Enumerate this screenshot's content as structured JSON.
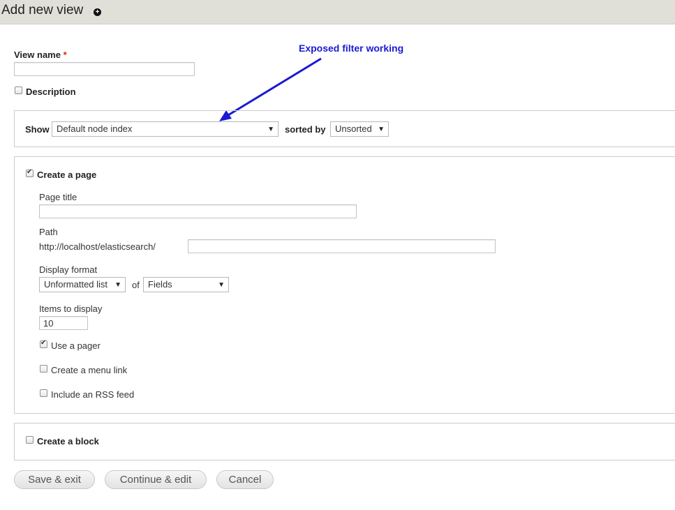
{
  "header": {
    "title": "Add new view"
  },
  "view_name": {
    "label": "View name",
    "required_marker": "*",
    "value": ""
  },
  "description": {
    "label": "Description",
    "checked": false
  },
  "show": {
    "label": "Show",
    "selected": "Default node index",
    "sorted_by_label": "sorted by",
    "sorted_by_selected": "Unsorted"
  },
  "annotation": {
    "text": "Exposed filter working"
  },
  "create_page": {
    "label": "Create a page",
    "checked": true,
    "page_title": {
      "label": "Page title",
      "value": ""
    },
    "path": {
      "label": "Path",
      "prefix": "http://localhost/elasticsearch/",
      "value": ""
    },
    "display_format": {
      "label": "Display format",
      "selected": "Unformatted list",
      "of_label": "of",
      "of_selected": "Fields"
    },
    "items_to_display": {
      "label": "Items to display",
      "value": "10"
    },
    "use_pager": {
      "label": "Use a pager",
      "checked": true
    },
    "menu_link": {
      "label": "Create a menu link",
      "checked": false
    },
    "rss_feed": {
      "label": "Include an RSS feed",
      "checked": false
    }
  },
  "create_block": {
    "label": "Create a block",
    "checked": false
  },
  "buttons": {
    "save_exit": "Save & exit",
    "continue_edit": "Continue & edit",
    "cancel": "Cancel"
  },
  "colors": {
    "header_bg": "#e1e0d8",
    "annotation": "#1a1ad4",
    "required": "#e32700"
  }
}
